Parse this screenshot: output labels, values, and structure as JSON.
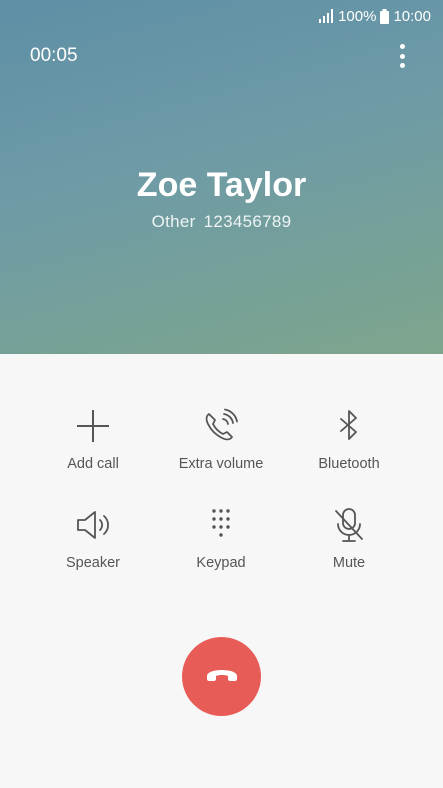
{
  "status_bar": {
    "battery": "100%",
    "time": "10:00",
    "icons": [
      "signal-icon",
      "battery-icon"
    ]
  },
  "call": {
    "timer": "00:05",
    "contact_name": "Zoe Taylor",
    "number_label": "Other",
    "number": "123456789"
  },
  "controls": [
    {
      "label": "Add call",
      "icon": "plus-icon"
    },
    {
      "label": "Extra volume",
      "icon": "extra-volume-icon"
    },
    {
      "label": "Bluetooth",
      "icon": "bluetooth-icon"
    },
    {
      "label": "Speaker",
      "icon": "speaker-icon"
    },
    {
      "label": "Keypad",
      "icon": "keypad-icon"
    },
    {
      "label": "Mute",
      "icon": "mute-icon"
    }
  ],
  "colors": {
    "end_call": "#e85c57",
    "header_gradient_start": "#5e8fa5",
    "header_gradient_end": "#7ea58c",
    "icon": "#555555"
  }
}
